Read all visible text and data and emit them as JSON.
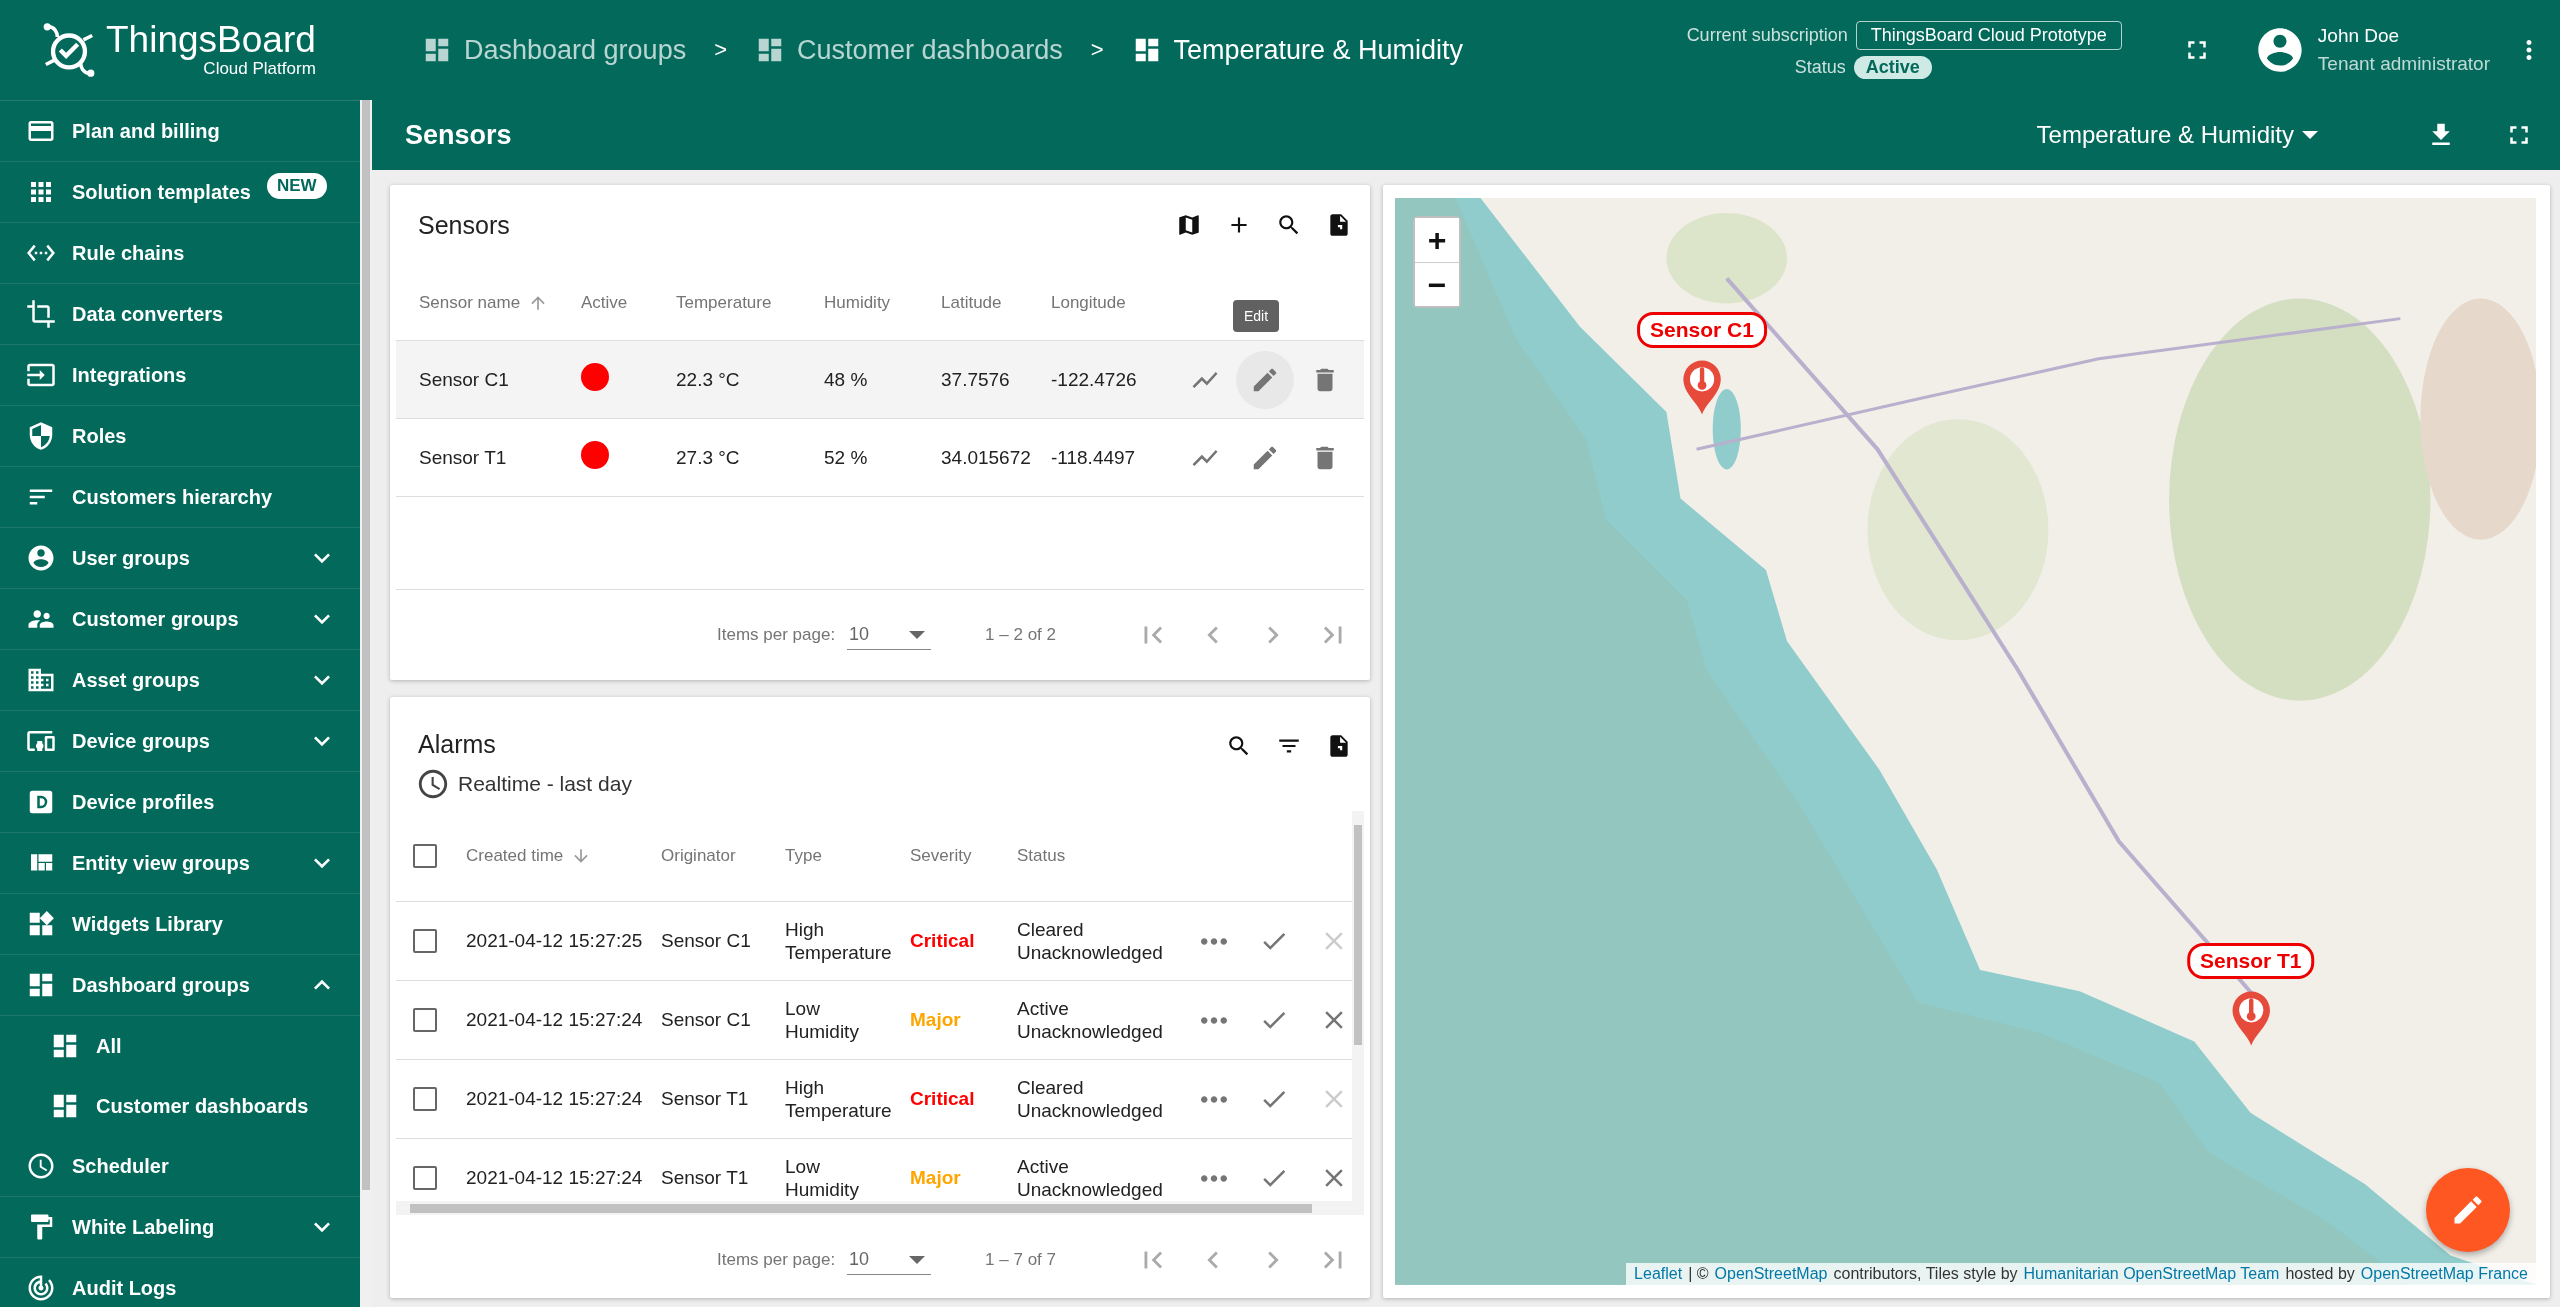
{
  "header": {
    "logo": {
      "title": "ThingsBoard",
      "subtitle": "Cloud Platform"
    },
    "breadcrumbs": [
      {
        "label": "Dashboard groups",
        "current": false
      },
      {
        "label": "Customer dashboards",
        "current": false
      },
      {
        "label": "Temperature & Humidity",
        "current": true
      }
    ],
    "separator": ">",
    "subscription": {
      "label": "Current subscription",
      "plan": "ThingsBoard Cloud Prototype",
      "status_label": "Status",
      "status": "Active"
    },
    "user": {
      "name": "John Doe",
      "role": "Tenant administrator"
    }
  },
  "sidebar": {
    "items": [
      {
        "label": "Plan and billing",
        "kind": "link"
      },
      {
        "label": "Solution templates",
        "kind": "link",
        "badge": "NEW"
      },
      {
        "label": "Rule chains",
        "kind": "link"
      },
      {
        "label": "Data converters",
        "kind": "link"
      },
      {
        "label": "Integrations",
        "kind": "link"
      },
      {
        "label": "Roles",
        "kind": "link"
      },
      {
        "label": "Customers hierarchy",
        "kind": "link"
      },
      {
        "label": "User groups",
        "kind": "group",
        "expanded": false
      },
      {
        "label": "Customer groups",
        "kind": "group",
        "expanded": false
      },
      {
        "label": "Asset groups",
        "kind": "group",
        "expanded": false
      },
      {
        "label": "Device groups",
        "kind": "group",
        "expanded": false
      },
      {
        "label": "Device profiles",
        "kind": "link"
      },
      {
        "label": "Entity view groups",
        "kind": "group",
        "expanded": false
      },
      {
        "label": "Widgets Library",
        "kind": "link"
      },
      {
        "label": "Dashboard groups",
        "kind": "group",
        "expanded": true,
        "children": [
          {
            "label": "All"
          },
          {
            "label": "Customer dashboards"
          }
        ]
      },
      {
        "label": "Scheduler",
        "kind": "link"
      },
      {
        "label": "White Labeling",
        "kind": "group",
        "expanded": false
      },
      {
        "label": "Audit Logs",
        "kind": "link"
      }
    ]
  },
  "dashboard": {
    "title": "Sensors",
    "state": "Temperature & Humidity"
  },
  "sensors": {
    "title": "Sensors",
    "columns": [
      {
        "label": "Sensor name",
        "sorted": true,
        "descending": false
      },
      {
        "label": "Active",
        "sorted": false
      },
      {
        "label": "Temperature",
        "sorted": false
      },
      {
        "label": "Humidity",
        "sorted": false
      },
      {
        "label": "Latitude",
        "sorted": false
      },
      {
        "label": "Longitude",
        "sorted": false
      }
    ],
    "tooltip": "Edit",
    "rows": [
      {
        "name": "Sensor C1",
        "color": "#ff0000",
        "temperature": "22.3 °C",
        "humidity": "48 %",
        "latitude": "37.7576",
        "longitude": "-122.4726",
        "hovered": true
      },
      {
        "name": "Sensor T1",
        "color": "#ff0000",
        "temperature": "27.3 °C",
        "humidity": "52 %",
        "latitude": "34.015672",
        "longitude": "-118.4497",
        "hovered": false
      }
    ],
    "pagination": {
      "label": "Items per page:",
      "page_size": "10",
      "range": "1 – 2 of 2"
    }
  },
  "alarms": {
    "title": "Alarms",
    "timewindow": "Realtime - last day",
    "all_selected": false,
    "columns": [
      {
        "label": "Created time",
        "sorted": true,
        "descending": true
      },
      {
        "label": "Originator",
        "sorted": false
      },
      {
        "label": "Type",
        "sorted": false
      },
      {
        "label": "Severity",
        "sorted": false
      },
      {
        "label": "Status",
        "sorted": false
      }
    ],
    "rows": [
      {
        "selected": false,
        "created": "2021-04-12 15:27:25",
        "originator": "Sensor C1",
        "type": [
          "High",
          "Temperature"
        ],
        "severity": "Critical",
        "color": "#ff0000",
        "status": [
          "Cleared",
          "Unacknowledged"
        ],
        "clear_disabled": true
      },
      {
        "selected": false,
        "created": "2021-04-12 15:27:24",
        "originator": "Sensor C1",
        "type": [
          "Low",
          "Humidity"
        ],
        "severity": "Major",
        "color": "#ffa500",
        "status": [
          "Active",
          "Unacknowledged"
        ],
        "clear_disabled": false
      },
      {
        "selected": false,
        "created": "2021-04-12 15:27:24",
        "originator": "Sensor T1",
        "type": [
          "High",
          "Temperature"
        ],
        "severity": "Critical",
        "color": "#ff0000",
        "status": [
          "Cleared",
          "Unacknowledged"
        ],
        "clear_disabled": true
      },
      {
        "selected": false,
        "created": "2021-04-12 15:27:24",
        "originator": "Sensor T1",
        "type": [
          "Low",
          "Humidity"
        ],
        "severity": "Major",
        "color": "#ffa500",
        "status": [
          "Active",
          "Unacknowledged"
        ],
        "clear_disabled": false
      }
    ],
    "pagination": {
      "label": "Items per page:",
      "page_size": "10",
      "range": "1 – 7 of 7"
    }
  },
  "map": {
    "zoom_in": "+",
    "zoom_out": "−",
    "markers": [
      {
        "label": "Sensor C1"
      },
      {
        "label": "Sensor T1"
      }
    ],
    "attribution": [
      {
        "text": "Leaflet",
        "link": true
      },
      {
        "text": "| ©",
        "link": false
      },
      {
        "text": "OpenStreetMap",
        "link": true
      },
      {
        "text": "contributors, Tiles style by",
        "link": false
      },
      {
        "text": "Humanitarian OpenStreetMap Team",
        "link": true
      },
      {
        "text": "hosted by",
        "link": false
      },
      {
        "text": "OpenStreetMap France",
        "link": true
      }
    ]
  }
}
